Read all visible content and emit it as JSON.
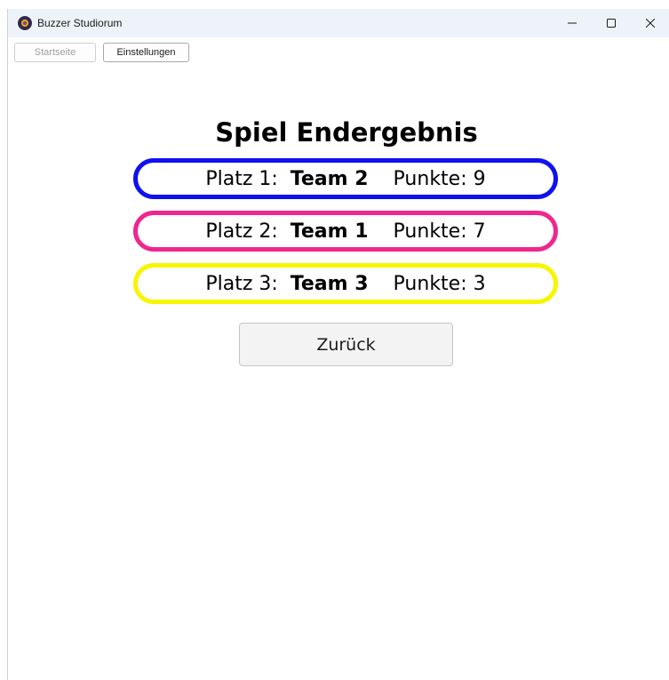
{
  "window": {
    "title": "Buzzer Studiorum"
  },
  "toolbar": {
    "home_label": "Startseite",
    "settings_label": "Einstellungen"
  },
  "main": {
    "heading": "Spiel Endergebnis",
    "results": [
      {
        "place_label": "Platz 1:",
        "team": "Team 2",
        "points_label": "Punkte: 9",
        "color": "#1010f0"
      },
      {
        "place_label": "Platz 2:",
        "team": "Team 1",
        "points_label": "Punkte: 7",
        "color": "#f0268f"
      },
      {
        "place_label": "Platz 3:",
        "team": "Team 3",
        "points_label": "Punkte: 3",
        "color": "#f7f500"
      }
    ],
    "back_label": "Zurück"
  },
  "icons": {
    "app": "buzzer-app-icon",
    "minimize": "minimize-icon",
    "maximize": "maximize-icon",
    "close": "close-icon"
  }
}
